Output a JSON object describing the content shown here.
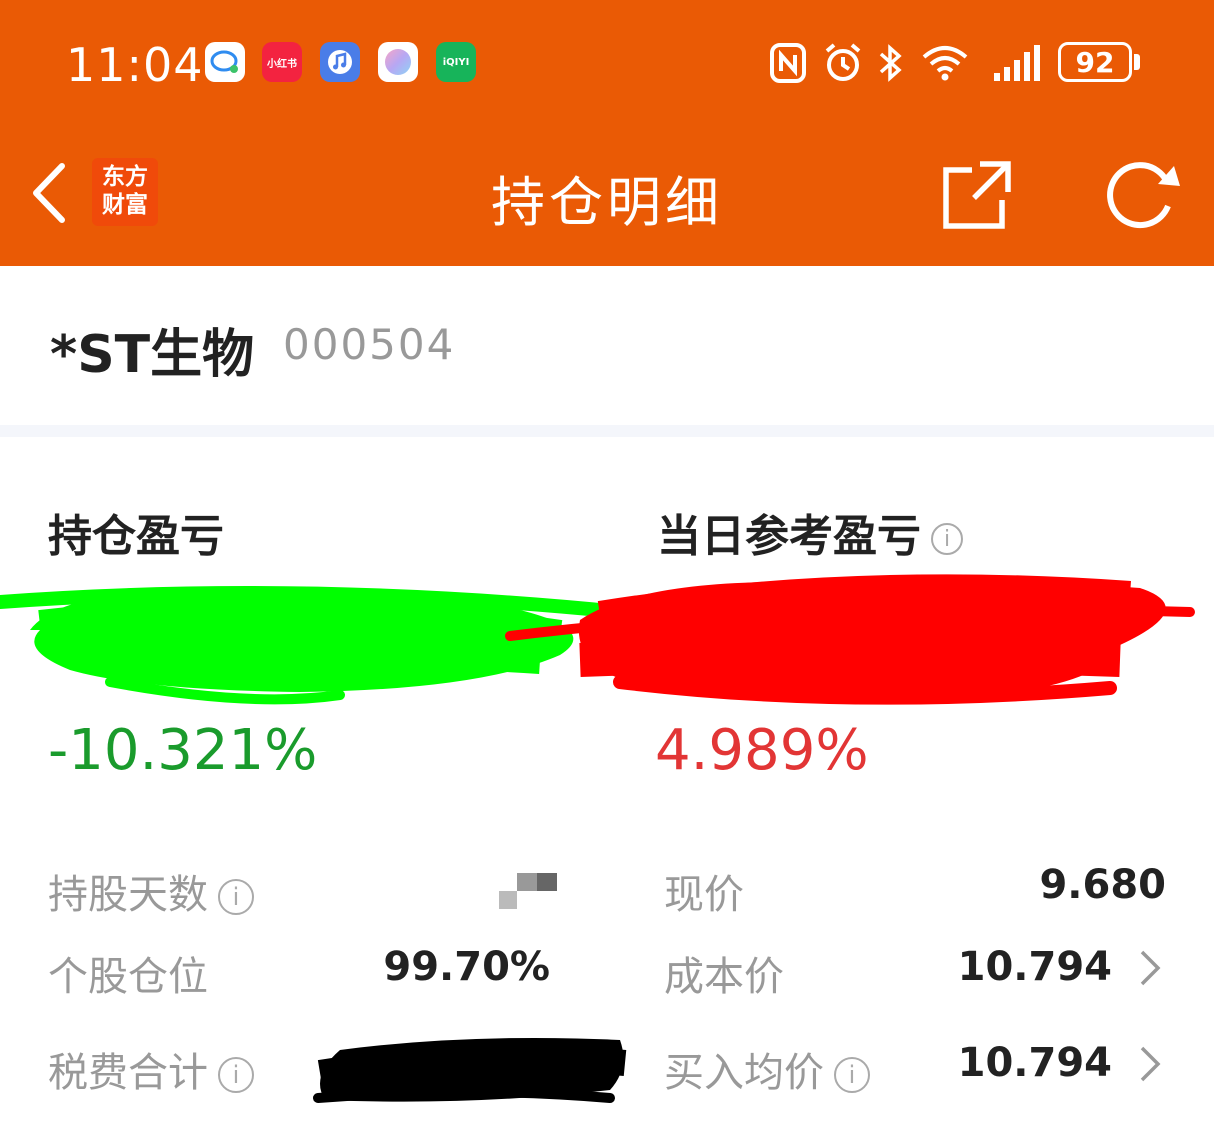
{
  "status_bar": {
    "time": "11:04",
    "battery": "92",
    "app_icons": [
      "chat-app-icon",
      "xiaohongshu-icon",
      "music-icon",
      "gallery-icon",
      "iqiyi-icon"
    ],
    "app_icon_texts": {
      "xiaohongshu": "小红书",
      "iqiyi": "iQIYI"
    },
    "status_icons": [
      "nfc-icon",
      "alarm-icon",
      "bluetooth-icon",
      "wifi-icon",
      "signal-icon",
      "battery-icon"
    ]
  },
  "nav": {
    "title": "持仓明细",
    "logo_line1": "东方",
    "logo_line2": "财富"
  },
  "stock": {
    "name": "*ST生物",
    "code": "000504"
  },
  "pl": {
    "holding_label": "持仓盈亏",
    "holding_pct": "-10.321%",
    "daily_label": "当日参考盈亏",
    "daily_pct": "4.989%"
  },
  "details": {
    "hold_days_label": "持股天数",
    "position_label": "个股仓位",
    "position_value": "99.70%",
    "fees_label": "税费合计",
    "price_label": "现价",
    "price_value": "9.680",
    "cost_label": "成本价",
    "cost_value": "10.794",
    "avg_buy_label": "买入均价",
    "avg_buy_value": "10.794"
  },
  "colors": {
    "header": "#ea5a05",
    "loss_green": "#1a9b2c",
    "gain_red": "#e23535"
  }
}
